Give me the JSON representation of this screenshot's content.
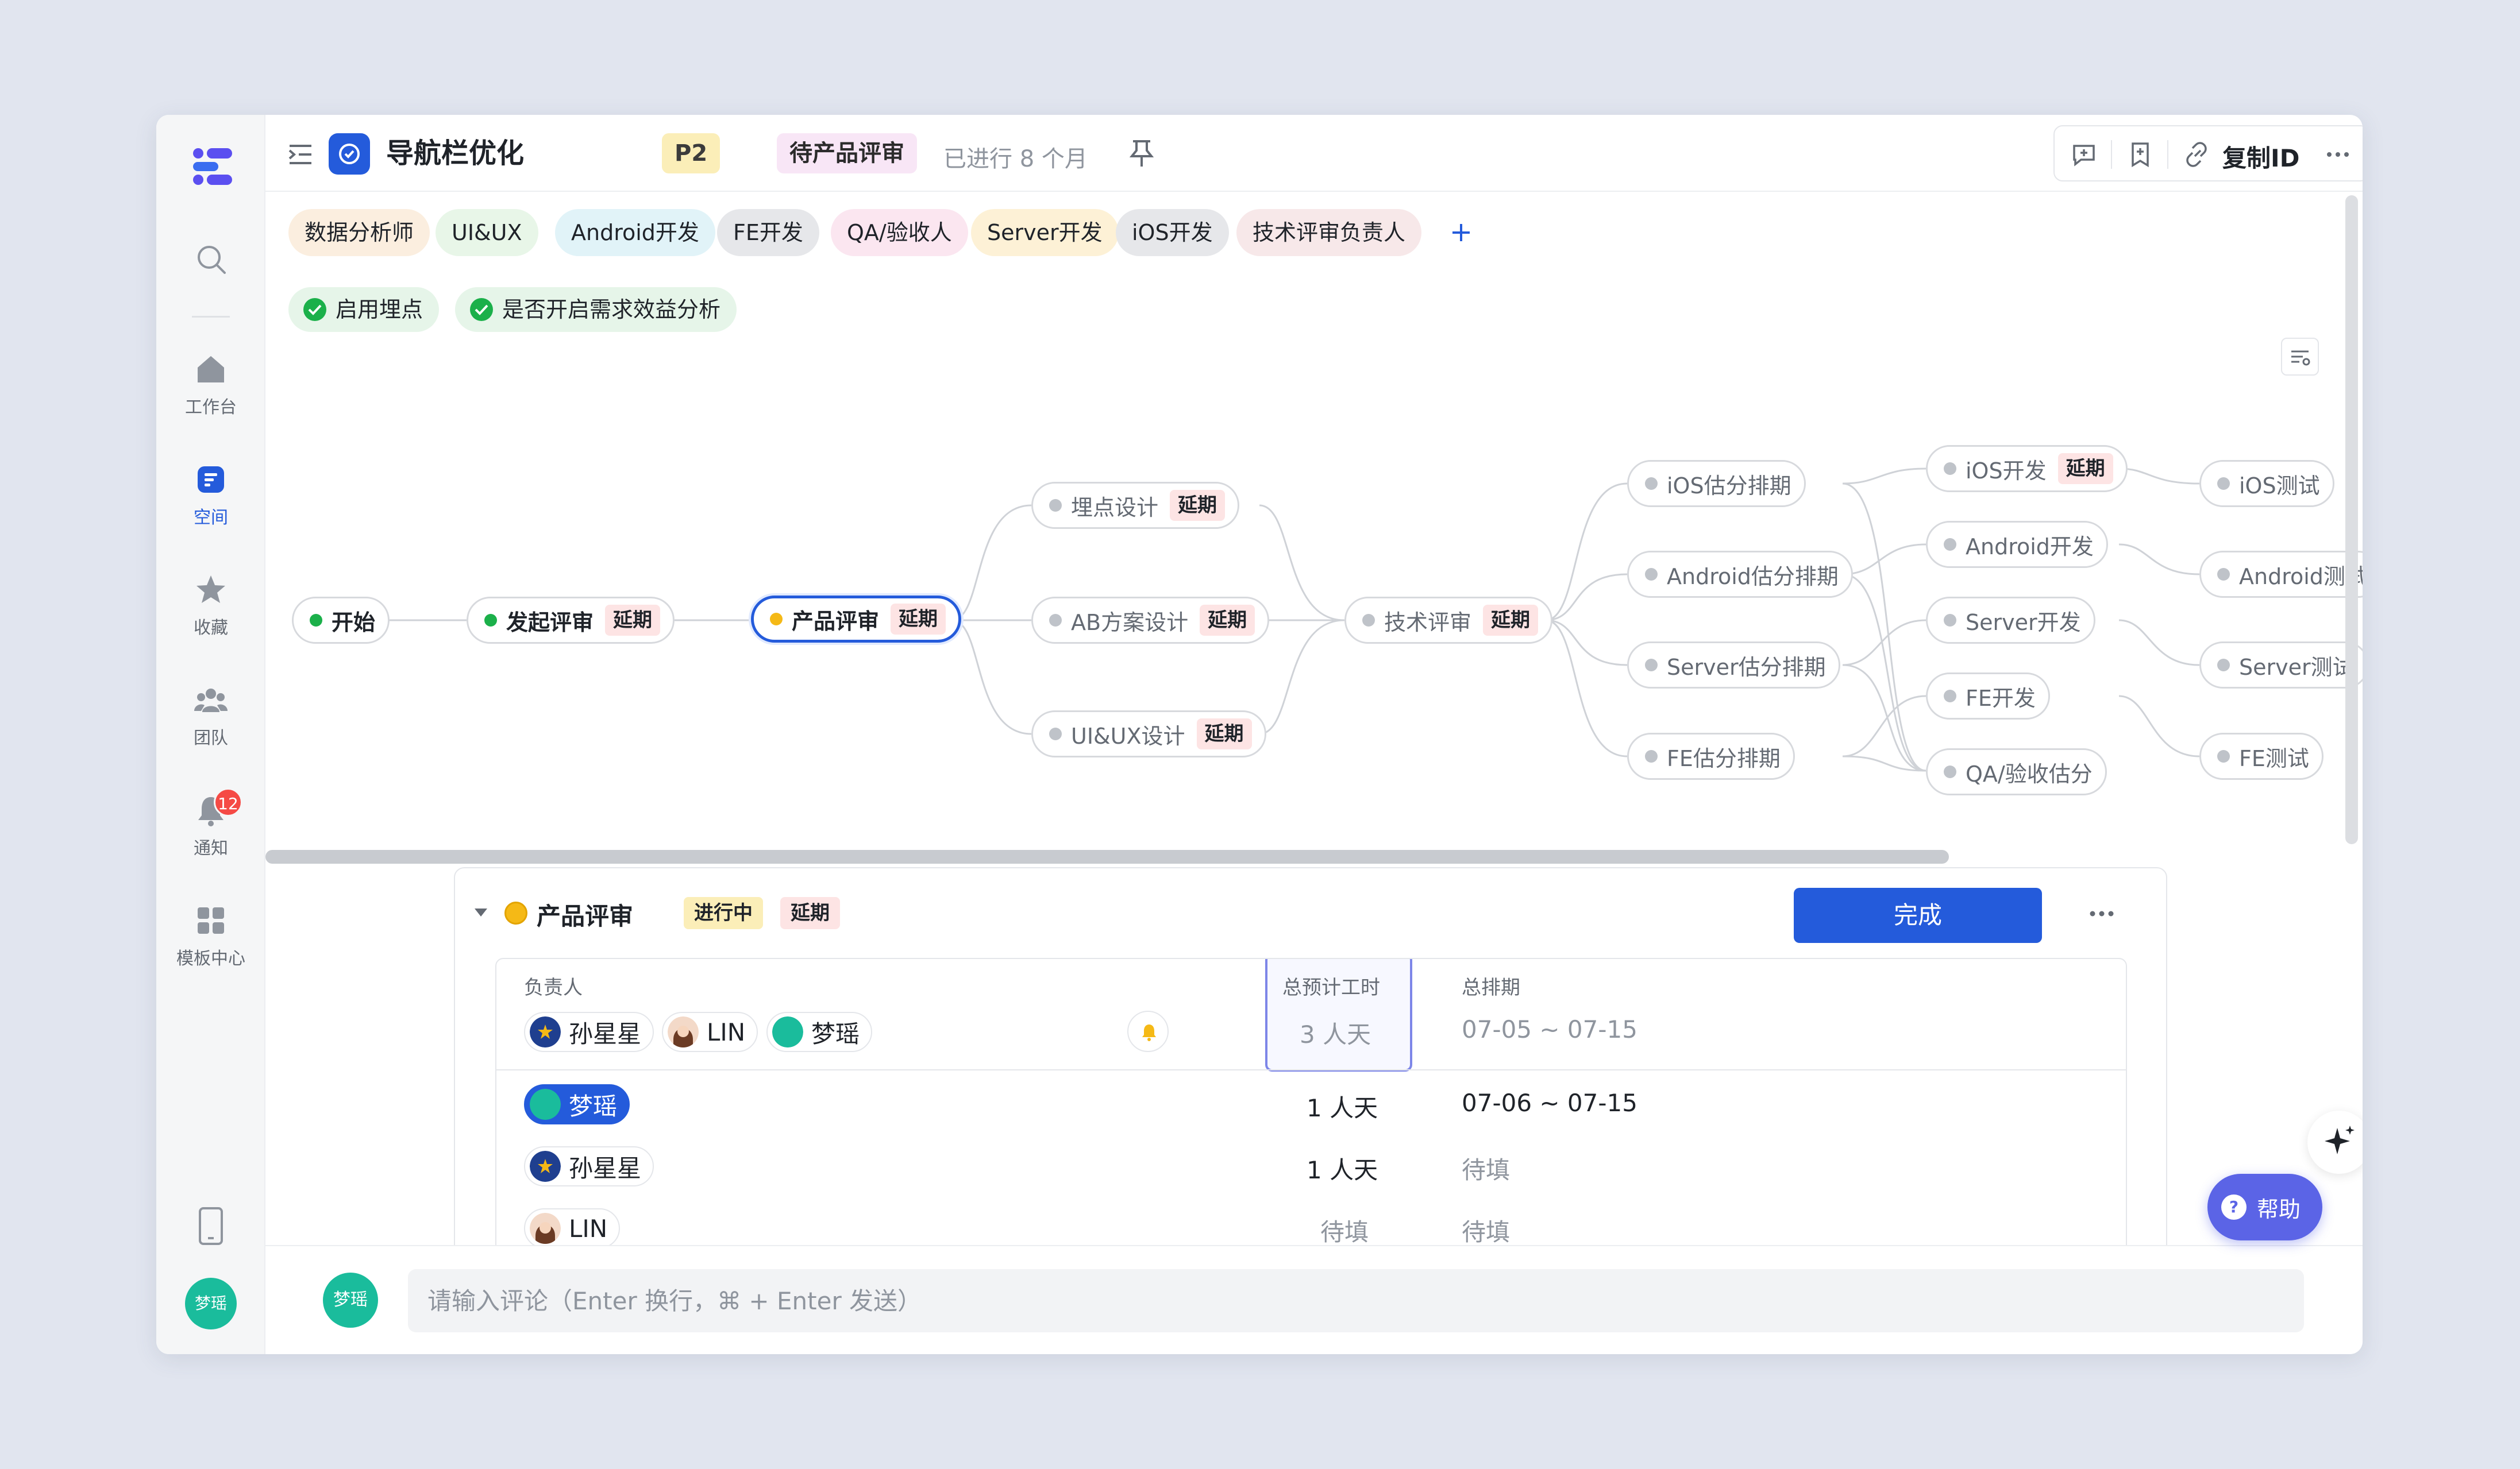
{
  "rail": {
    "nav": [
      {
        "label": "工作台",
        "icon": "home-icon"
      },
      {
        "label": "空间",
        "icon": "space-icon"
      },
      {
        "label": "收藏",
        "icon": "star-icon"
      },
      {
        "label": "团队",
        "icon": "team-icon"
      },
      {
        "label": "通知",
        "icon": "bell-icon",
        "badge": "12"
      },
      {
        "label": "模板中心",
        "icon": "template-icon"
      }
    ],
    "user_avatar": "梦瑶"
  },
  "header": {
    "title": "导航栏优化",
    "priority": "P2",
    "status": "待产品评审",
    "elapsed": "已进行 8 个月",
    "copy_id_label": "复制ID"
  },
  "roles": [
    "数据分析师",
    "UI&UX",
    "Android开发",
    "FE开发",
    "QA/验收人",
    "Server开发",
    "iOS开发",
    "技术评审负责人"
  ],
  "role_colors": [
    "#fbeedf",
    "#e8f6e8",
    "#e1f3f8",
    "#e6e7ea",
    "#fbe6f0",
    "#fdf1d6",
    "#e6e7ea",
    "#f7e8e9"
  ],
  "checks": [
    "启用埋点",
    "是否开启需求效益分析"
  ],
  "flow": {
    "delay_label": "延期",
    "nodes": {
      "start": "开始",
      "initiate": "发起评审",
      "product_review": "产品评审",
      "tracking_design": "埋点设计",
      "ab_design": "AB方案设计",
      "uiux_design": "UI&UX设计",
      "tech_review": "技术评审",
      "ios_estimate": "iOS估分排期",
      "android_estimate": "Android估分排期",
      "server_estimate": "Server估分排期",
      "fe_estimate": "FE估分排期",
      "ios_dev": "iOS开发",
      "android_dev": "Android开发",
      "server_dev": "Server开发",
      "fe_dev": "FE开发",
      "qa_estimate": "QA/验收估分",
      "ios_test": "iOS测试",
      "android_test": "Android测试",
      "server_test": "Server测试",
      "fe_test": "FE测试"
    }
  },
  "panel": {
    "title": "产品评审",
    "progress": "进行中",
    "delay": "延期",
    "done_button": "完成",
    "columns": {
      "owner": "负责人",
      "est_hours": "总预计工时",
      "schedule": "总排期"
    },
    "owners": [
      "孙星星",
      "LIN",
      "梦瑶"
    ],
    "summary": {
      "hours": "3 人天",
      "schedule": "07-05 ~ 07-15"
    },
    "rows": [
      {
        "name": "梦瑶",
        "hours": "1 人天",
        "schedule": "07-06 ~ 07-15"
      },
      {
        "name": "孙星星",
        "hours": "1 人天",
        "schedule": "待填"
      },
      {
        "name": "LIN",
        "hours": "待填",
        "schedule": "待填"
      }
    ]
  },
  "comment": {
    "avatar": "梦瑶",
    "placeholder": "请输入评论（Enter 换行，⌘ + Enter 发送）"
  },
  "help_label": "帮助",
  "colors": {
    "accent": "#245bdb",
    "done": "#1bb04a",
    "current": "#f5b916",
    "delay_bg": "#fde4e4"
  }
}
